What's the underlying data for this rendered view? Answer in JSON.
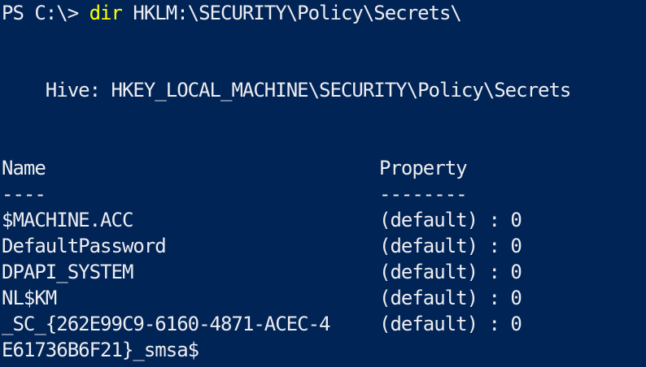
{
  "colors": {
    "background": "#012456",
    "text": "#eeedf0",
    "command": "#ffff00"
  },
  "prompt": {
    "prefix": "PS C:\\> ",
    "command": "dir",
    "argument": " HKLM:\\SECURITY\\Policy\\Secrets\\"
  },
  "hive": {
    "label": "    Hive: ",
    "path": "HKEY_LOCAL_MACHINE\\SECURITY\\Policy\\Secrets"
  },
  "table": {
    "headers": {
      "name": "Name",
      "property": "Property"
    },
    "separators": {
      "name": "----",
      "property": "--------"
    },
    "rows": [
      {
        "name": "$MACHINE.ACC",
        "property": "(default) : 0"
      },
      {
        "name": "DefaultPassword",
        "property": "(default) : 0"
      },
      {
        "name": "DPAPI_SYSTEM",
        "property": "(default) : 0"
      },
      {
        "name": "NL$KM",
        "property": "(default) : 0"
      },
      {
        "name": "_SC_{262E99C9-6160-4871-ACEC-4",
        "property": "(default) : 0"
      },
      {
        "name": "E61736B6F21}_smsa$",
        "property": ""
      }
    ]
  }
}
